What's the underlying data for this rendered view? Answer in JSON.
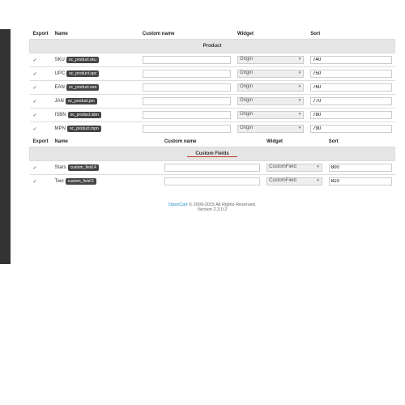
{
  "headers": {
    "export": "Export",
    "name": "Name",
    "custom_name": "Custom name",
    "widget": "Widget",
    "sort": "Sort"
  },
  "sections": {
    "product": "Product",
    "custom_fields": "Custom Fields"
  },
  "widget_options": {
    "origin": "Origin",
    "custom_field": "CustomField"
  },
  "product_rows": [
    {
      "label": "SKU",
      "tag": "oc_product.sku",
      "widget": "Origin",
      "sort": "740"
    },
    {
      "label": "UPC",
      "tag": "oc_product.upc",
      "widget": "Origin",
      "sort": "750"
    },
    {
      "label": "EAN",
      "tag": "oc_product.ean",
      "widget": "Origin",
      "sort": "760"
    },
    {
      "label": "JAN",
      "tag": "oc_product.jan",
      "widget": "Origin",
      "sort": "770"
    },
    {
      "label": "ISBN",
      "tag": "oc_product.isbn",
      "widget": "Origin",
      "sort": "780"
    },
    {
      "label": "MPN",
      "tag": "oc_product.mpn",
      "widget": "Origin",
      "sort": "790"
    }
  ],
  "custom_field_rows": [
    {
      "label": "Stars",
      "tag": "custom_field.4",
      "widget": "CustomField",
      "sort": "800"
    },
    {
      "label": "Two",
      "tag": "custom_field.5",
      "widget": "CustomField",
      "sort": "810"
    }
  ],
  "footer": {
    "brand": "OpenCart",
    "copyright": " © 2009-2015 All Rights Reserved.",
    "version": "Version 2.3.0.2"
  },
  "check": "✓"
}
